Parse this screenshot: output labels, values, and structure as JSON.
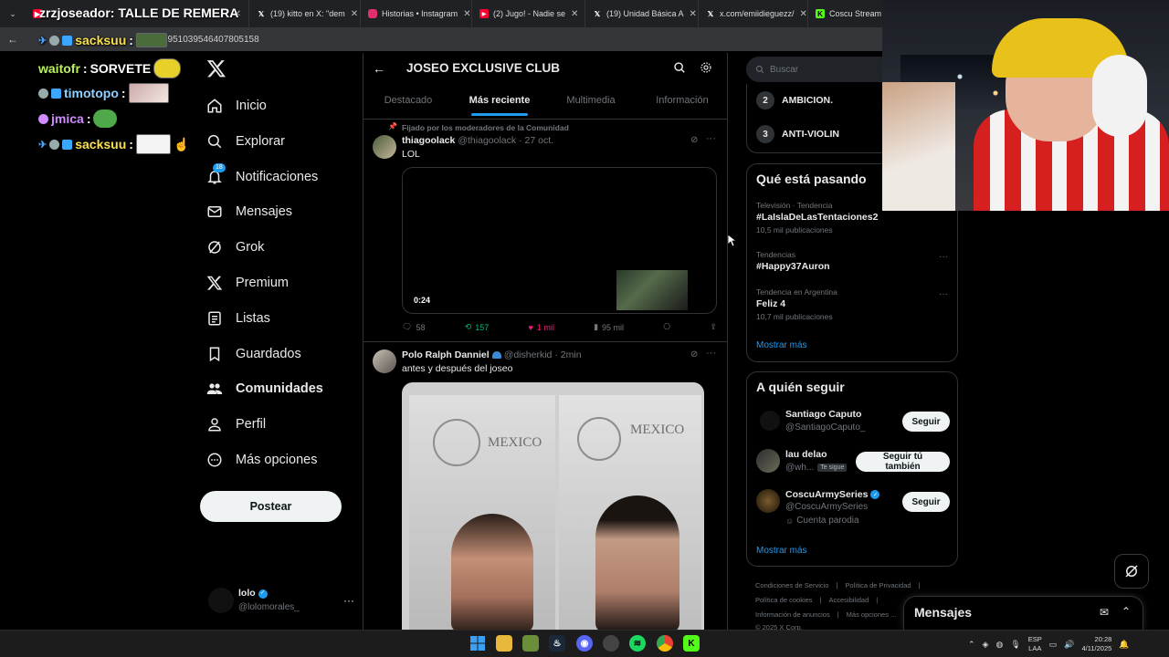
{
  "browser": {
    "tabs": [
      {
        "label": "",
        "overlay_title": "zrzjoseador: TALLE DE REMERA",
        "icon": "youtube-icon",
        "color": "#ff0033"
      },
      {
        "label": "(19) kitto en X: \"dem",
        "icon": "x-logo-icon",
        "color": "#ffffff"
      },
      {
        "label": "Historias • Instagram",
        "icon": "instagram-icon",
        "color": "#e1306c"
      },
      {
        "label": "(2) Jugo! - Nadie se",
        "icon": "youtube-icon",
        "color": "#ff0033"
      },
      {
        "label": "(19) Unidad Básica A",
        "icon": "x-logo-icon",
        "color": "#ffffff"
      },
      {
        "label": "x.com/emiidieguezz/",
        "icon": "x-logo-icon",
        "color": "#ffffff"
      },
      {
        "label": "Coscu Stream -",
        "icon": "kick-icon",
        "color": "#53fc18"
      }
    ],
    "url": "…1951039546407805158"
  },
  "chat": [
    {
      "user": "sacksuu",
      "sep": ":",
      "message": "",
      "color": "#f8e04b"
    },
    {
      "user": "waitofr",
      "sep": ":",
      "message": "SORVETE",
      "color": "#b8f15e"
    },
    {
      "user": "timotopo",
      "sep": ":",
      "message": "",
      "color": "#8fd0ff"
    },
    {
      "user": "jmica",
      "sep": ":",
      "message": "",
      "color": "#d08bff"
    },
    {
      "user": "sacksuu",
      "sep": ":",
      "message": "",
      "color": "#f8e04b"
    }
  ],
  "nav": {
    "items": [
      {
        "label": "Inicio",
        "icon": "home-icon"
      },
      {
        "label": "Explorar",
        "icon": "search-icon"
      },
      {
        "label": "Notificaciones",
        "icon": "bell-icon",
        "badge": "18"
      },
      {
        "label": "Mensajes",
        "icon": "mail-icon"
      },
      {
        "label": "Grok",
        "icon": "grok-icon"
      },
      {
        "label": "Premium",
        "icon": "x-logo-icon"
      },
      {
        "label": "Listas",
        "icon": "list-icon"
      },
      {
        "label": "Guardados",
        "icon": "bookmark-icon"
      },
      {
        "label": "Comunidades",
        "icon": "communities-icon",
        "active": true
      },
      {
        "label": "Perfil",
        "icon": "person-icon"
      },
      {
        "label": "Más opciones",
        "icon": "more-circle-icon"
      }
    ],
    "post_label": "Postear",
    "account": {
      "name": "lolo",
      "handle": "@lolomorales_"
    }
  },
  "main": {
    "title": "JOSEO EXCLUSIVE CLUB",
    "tabs": [
      "Destacado",
      "Más reciente",
      "Multimedia",
      "Información"
    ],
    "active_tab": "Más reciente",
    "posts": [
      {
        "pinned": "Fijado por los moderadores de la Comunidad",
        "name": "thiagoolack",
        "handle": "@thiagoolack",
        "time": "· 27 oct.",
        "text": "LOL",
        "video_time": "0:24",
        "replies": "58",
        "reposts": "157",
        "likes": "1 mil",
        "views": "95 mil"
      },
      {
        "name": "Polo Ralph Danniel",
        "handle": "@disherkid",
        "time": "· 2min",
        "text": "antes y después del joseo",
        "image_text_left": "MEXICO",
        "image_text_right": "MEXICO"
      }
    ]
  },
  "right": {
    "search_placeholder": "Buscar",
    "rules": [
      {
        "n": "2",
        "label": "AMBICION."
      },
      {
        "n": "3",
        "label": "ANTI-VIOLIN"
      }
    ],
    "trends_title": "Qué está pasando",
    "trends": [
      {
        "context": "Televisión · Tendencia",
        "title": "#LaIslaDeLasTentaciones2",
        "count": "10,5 mil publicaciones"
      },
      {
        "context": "Tendencias",
        "title": "#Happy37Auron",
        "count": ""
      },
      {
        "context": "Tendencia en Argentina",
        "title": "Feliz 4",
        "count": "10,7 mil publicaciones"
      }
    ],
    "show_more": "Mostrar más",
    "follow_title": "A quién seguir",
    "follow": [
      {
        "name": "Santiago Caputo",
        "handle": "@SantiagoCaputo_",
        "button": "Seguir",
        "extra": "",
        "follows_you": ""
      },
      {
        "name": "lau delao",
        "handle": "@wh...",
        "button": "Seguir tú también",
        "extra": "",
        "follows_you": "Te sigue"
      },
      {
        "name": "CoscuArmySeries",
        "handle": "@CoscuArmySeries",
        "button": "Seguir",
        "extra": "Cuenta parodia",
        "follows_you": "",
        "verified": true
      }
    ],
    "follow_more": "Mostrar más",
    "footer": {
      "line1": [
        "Condiciones de Servicio",
        "Política de Privacidad"
      ],
      "line2": [
        "Política de cookies",
        "Accesibilidad"
      ],
      "line3": [
        "Información de anuncios",
        "Más opciones ..."
      ],
      "copyright": "© 2025 X Corp."
    },
    "messages_label": "Mensajes"
  },
  "taskbar": {
    "lang": "ESP",
    "layout": "LAA",
    "time": "20:28",
    "date": "4/11/2025"
  }
}
